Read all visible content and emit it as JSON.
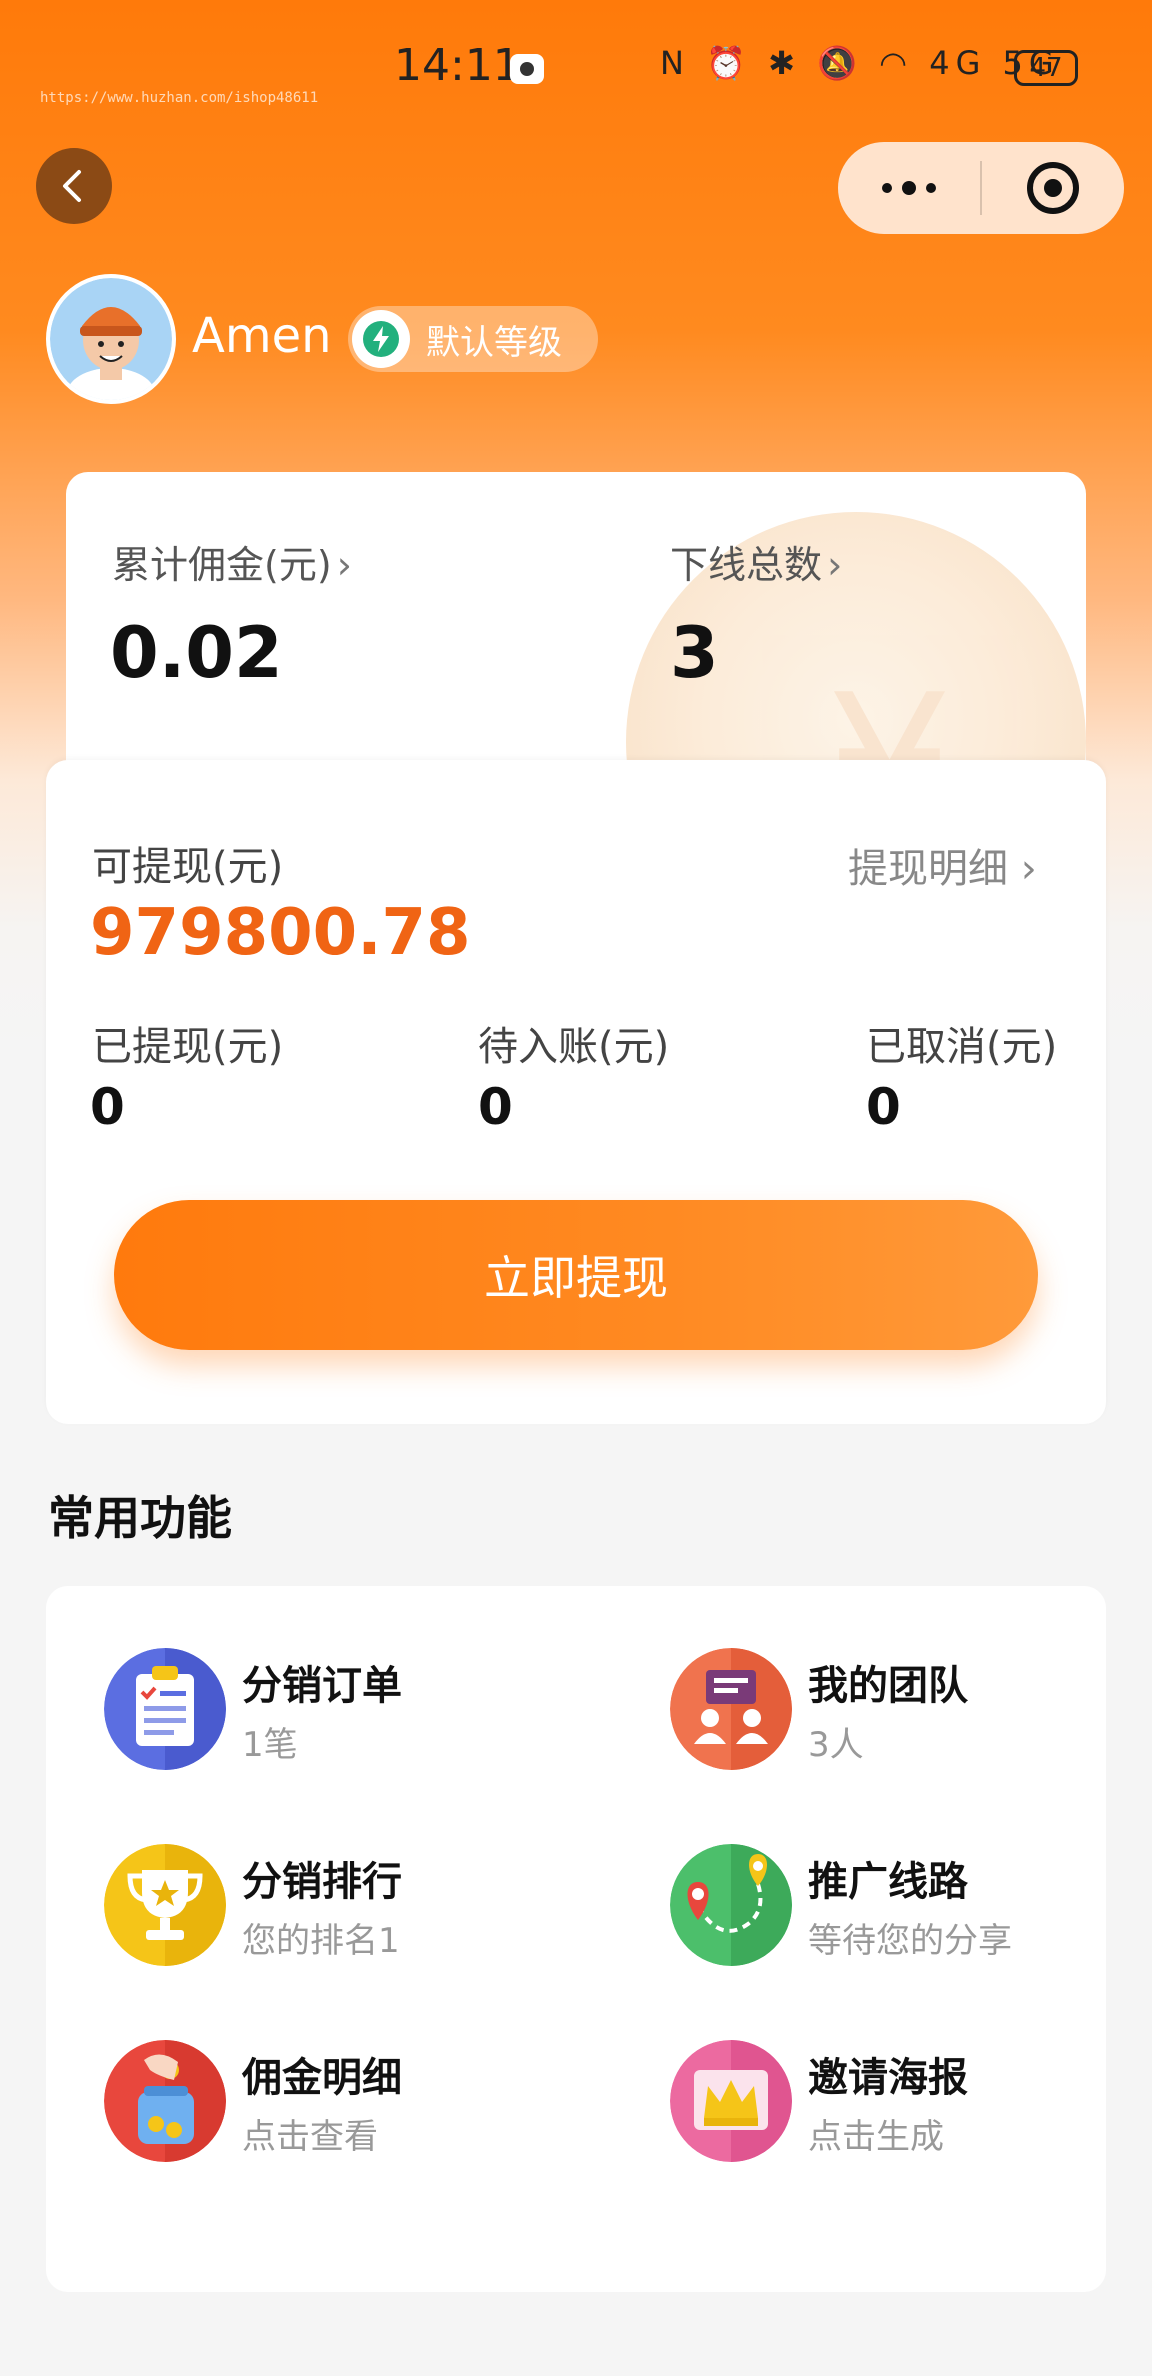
{
  "status_bar": {
    "time": "14:11",
    "network_icons": "N ⏰ ✱ 🔕 ◠ 4G 5G",
    "battery": "47",
    "watermark": "https://www.huzhan.com/ishop48611"
  },
  "nav": {
    "back_icon": "chevron-left-icon",
    "more_icon": "more-dots-icon",
    "close_icon": "target-circle-icon"
  },
  "profile": {
    "username": "Amen",
    "level": "默认等级"
  },
  "summary": {
    "commission_label": "累计佣金(元)",
    "commission_value": "0.02",
    "downline_label": "下线总数",
    "downline_value": "3"
  },
  "balance": {
    "withdrawable_label": "可提现(元)",
    "withdrawable_value": "979800.78",
    "detail_link": "提现明细",
    "withdrawn_label": "已提现(元)",
    "withdrawn_value": "0",
    "pending_label": "待入账(元)",
    "pending_value": "0",
    "cancelled_label": "已取消(元)",
    "cancelled_value": "0",
    "withdraw_button": "立即提现"
  },
  "functions": {
    "title": "常用功能",
    "items": [
      {
        "title": "分销订单",
        "sub": "1笔",
        "icon": "order-list-icon",
        "color": "#5b6ee1"
      },
      {
        "title": "我的团队",
        "sub": "3人",
        "icon": "team-icon",
        "color": "#f0734e"
      },
      {
        "title": "分销排行",
        "sub": "您的排名1",
        "icon": "trophy-icon",
        "color": "#f5c518"
      },
      {
        "title": "推广线路",
        "sub": "等待您的分享",
        "icon": "map-route-icon",
        "color": "#4cbf6b"
      },
      {
        "title": "佣金明细",
        "sub": "点击查看",
        "icon": "coin-jar-icon",
        "color": "#e8473d"
      },
      {
        "title": "邀请海报",
        "sub": "点击生成",
        "icon": "crown-poster-icon",
        "color": "#ec6aa0"
      }
    ]
  },
  "colors": {
    "accent": "#ff7a0d",
    "amount": "#f06414"
  }
}
